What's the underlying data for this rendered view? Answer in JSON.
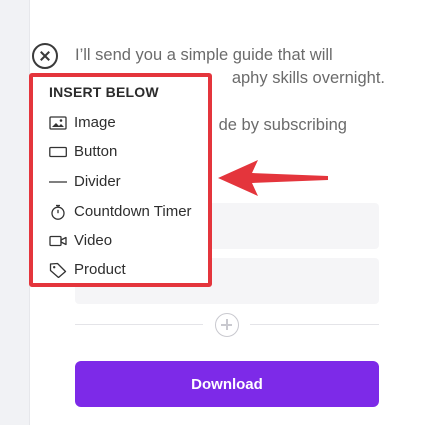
{
  "content": {
    "line1": "I’ll send you a simple guide that will",
    "line2": "aphy skills overnight.",
    "line3": "de by subscribing"
  },
  "form": {
    "download_label": "Download"
  },
  "insert_menu": {
    "title": "INSERT BELOW",
    "items": [
      {
        "label": "Image",
        "icon": "image-icon"
      },
      {
        "label": "Button",
        "icon": "button-icon"
      },
      {
        "label": "Divider",
        "icon": "divider-icon"
      },
      {
        "label": "Countdown Timer",
        "icon": "stopwatch-icon"
      },
      {
        "label": "Video",
        "icon": "video-camera-icon"
      },
      {
        "label": "Product",
        "icon": "tag-icon"
      }
    ]
  },
  "colors": {
    "accent_purple": "#7d2ae8",
    "highlight_red": "#e4353c"
  }
}
